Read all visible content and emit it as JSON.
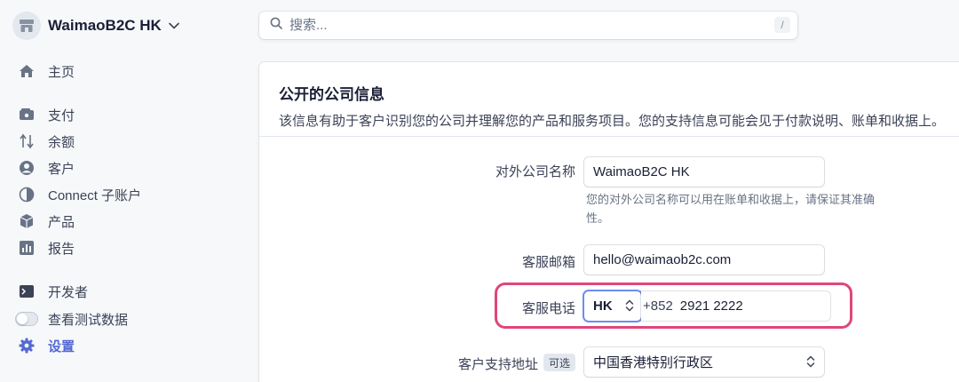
{
  "account": {
    "name": "WaimaoB2C HK"
  },
  "nav": {
    "home": "主页",
    "payments": "支付",
    "balances": "余额",
    "customers": "客户",
    "connect": "Connect 子账户",
    "products": "产品",
    "reports": "报告",
    "developers": "开发者",
    "test_data": "查看测试数据",
    "settings": "设置"
  },
  "search": {
    "placeholder": "搜索...",
    "shortcut": "/"
  },
  "section": {
    "title": "公开的公司信息",
    "description": "该信息有助于客户识别您的公司并理解您的产品和服务项目。您的支持信息可能会见于付款说明、账单和收据上。"
  },
  "form": {
    "public_name_label": "对外公司名称",
    "public_name_value": "WaimaoB2C HK",
    "public_name_help_line1": "您的对外公司名称可以用在账单和收据上，请保证其准确",
    "public_name_help_line2": "性。",
    "email_label": "客服邮箱",
    "email_value": "hello@waimaob2c.com",
    "phone_label": "客服电话",
    "phone_country": "HK",
    "phone_prefix": "+852",
    "phone_number": "2921 2222",
    "address_label": "客户支持地址",
    "address_optional": "可选",
    "address_country": "中国香港特别行政区"
  },
  "colors": {
    "accent": "#5469d4",
    "highlight": "#e0457b",
    "focus_ring": "#6d8cf0"
  }
}
